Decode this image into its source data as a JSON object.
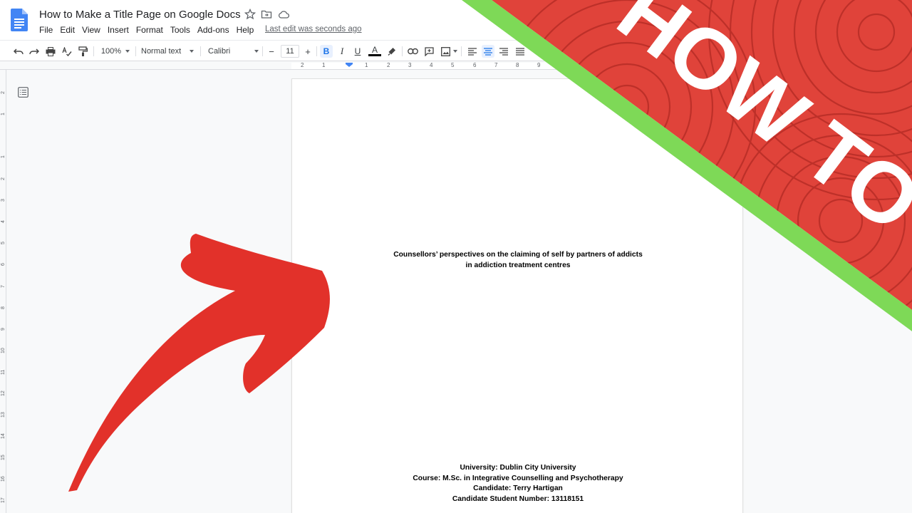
{
  "window": {
    "doc_title": "How to Make a Title Page on Google Docs",
    "last_edit": "Last edit was seconds ago"
  },
  "menu": [
    "File",
    "Edit",
    "View",
    "Insert",
    "Format",
    "Tools",
    "Add-ons",
    "Help"
  ],
  "toolbar": {
    "zoom": "100%",
    "style": "Normal text",
    "font": "Calibri",
    "font_size": "11",
    "bold_label": "B",
    "italic_label": "I",
    "underline_label": "U",
    "text_color_label": "A",
    "minus_label": "−",
    "plus_label": "+"
  },
  "ruler": {
    "top_numbers": [
      "2",
      "1",
      "1",
      "2",
      "3",
      "4",
      "5",
      "6",
      "7",
      "8",
      "9"
    ],
    "left_numbers": [
      "2",
      "1",
      "1",
      "2",
      "3",
      "4",
      "5",
      "6",
      "7",
      "8",
      "9",
      "10",
      "11",
      "12",
      "13",
      "14",
      "15",
      "16",
      "17"
    ]
  },
  "document": {
    "title_line1": "Counsellors’ perspectives on the claiming of self by partners of addicts",
    "title_line2": "in addiction treatment centres",
    "university": "University: Dublin City University",
    "course": "Course: M.Sc. in Integrative Counselling and Psychotherapy",
    "candidate": "Candidate: Terry Hartigan",
    "student_number": "Candidate Student Number: 13118151"
  },
  "overlay": {
    "banner_text": "HOW TO",
    "banner_color": "#e0433a",
    "stripe_color": "#7ed957",
    "arrow_color": "#e2312a"
  },
  "colors": {
    "accent": "#1a73e8",
    "docs_blue": "#4285f4"
  }
}
